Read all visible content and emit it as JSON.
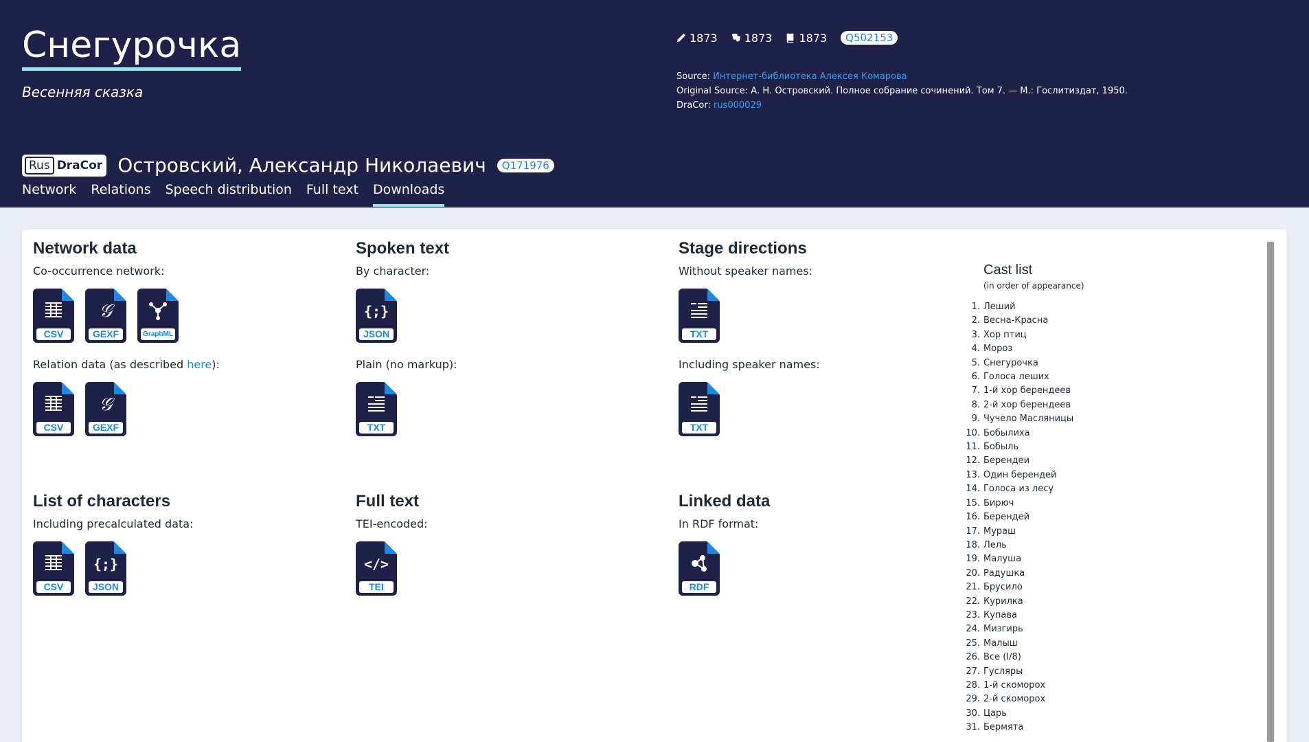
{
  "play": {
    "title": "Снегурочка",
    "subtitle": "Весенняя сказка",
    "years": {
      "written": "1873",
      "premiere": "1873",
      "print": "1873"
    },
    "wikidata": "Q502153"
  },
  "sources": {
    "source_label": "Source:",
    "source_link": "Интернет-библиотека Алексея Комарова",
    "original_label": "Original Source:",
    "original_text": "А. Н. Островский. Полное собрание сочинений. Том 7. — М.: Гослитиздат, 1950.",
    "dracor_label": "DraCor:",
    "dracor_id": "rus000029"
  },
  "corpus": {
    "rus": "Rus",
    "dracor": "DraCor"
  },
  "author": {
    "name": "Островский, Александр Николаевич",
    "wikidata": "Q171976"
  },
  "tabs": [
    "Network",
    "Relations",
    "Speech distribution",
    "Full text",
    "Downloads"
  ],
  "downloads": {
    "network": {
      "heading": "Network data",
      "cooc_label": "Co-occurrence network:",
      "relation_label_pre": "Relation data (as described ",
      "relation_link": "here",
      "relation_label_post": "):"
    },
    "spoken": {
      "heading": "Spoken text",
      "by_char": "By character:",
      "plain": "Plain (no markup):"
    },
    "stage": {
      "heading": "Stage directions",
      "without": "Without speaker names:",
      "including": "Including speaker names:"
    },
    "characters": {
      "heading": "List of characters",
      "label": "Including precalculated data:"
    },
    "fulltext": {
      "heading": "Full text",
      "label": "TEI-encoded:"
    },
    "linked": {
      "heading": "Linked data",
      "label": "In RDF format:"
    },
    "formats": {
      "csv": "CSV",
      "gexf": "GEXF",
      "graphml": "GraphML",
      "json": "JSON",
      "txt": "TXT",
      "tei": "TEI",
      "rdf": "RDF"
    }
  },
  "cast": {
    "heading": "Cast list",
    "subheading": "(in order of appearance)",
    "items": [
      "Леший",
      "Весна-Красна",
      "Хор птиц",
      "Мороз",
      "Снегурочка",
      "Голоса леших",
      "1-й хор берендеев",
      "2-й хор берендеев",
      "Чучело Масляницы",
      "Бобылиха",
      "Бобыль",
      "Берендеи",
      "Один берендей",
      "Голоса из лесу",
      "Бирюч",
      "Берендей",
      "Мураш",
      "Лель",
      "Малуша",
      "Радушка",
      "Брусило",
      "Курилка",
      "Купава",
      "Мизгирь",
      "Малыш",
      "Все (I/8)",
      "Гусляры",
      "1-й скоморох",
      "2-й скоморох",
      "Царь",
      "Бермята"
    ]
  }
}
